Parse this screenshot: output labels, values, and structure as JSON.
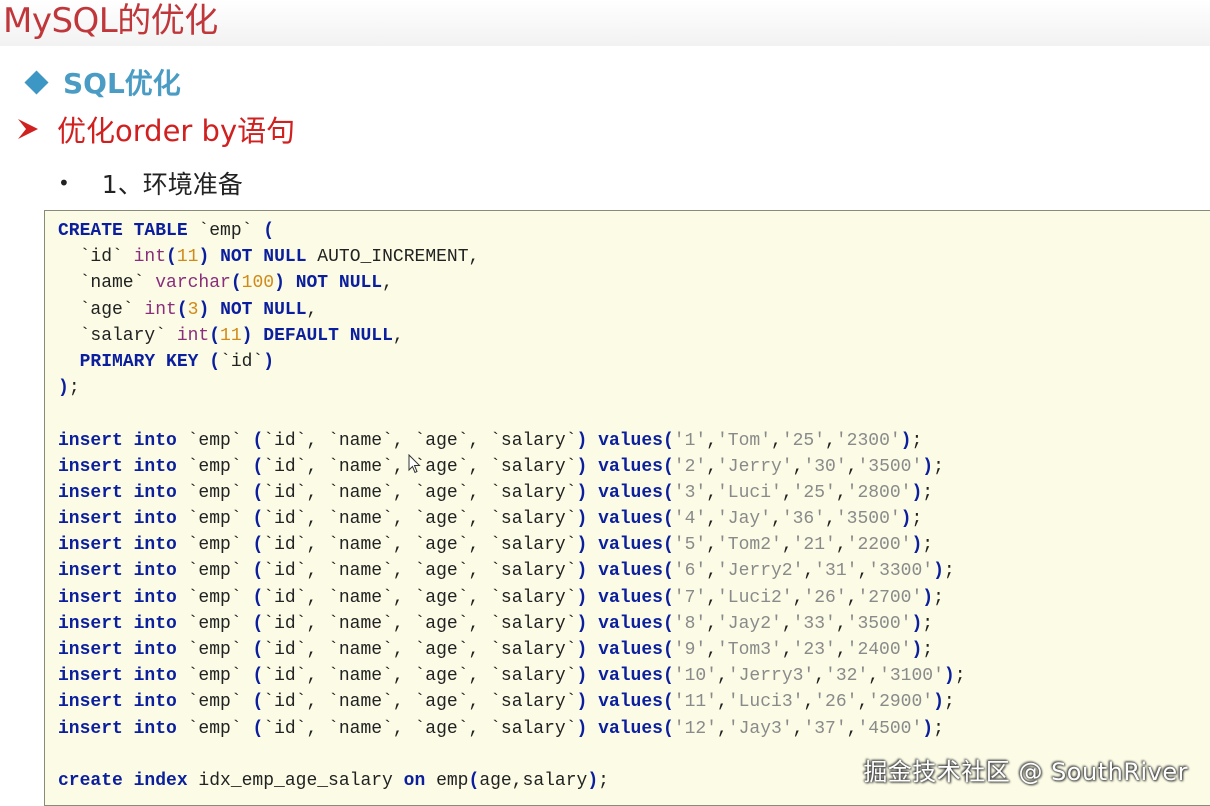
{
  "slide": {
    "title": "MySQL的优化",
    "heading1": "SQL优化",
    "heading2": "优化order by语句",
    "bullet": "1、环境准备"
  },
  "code": {
    "create_table": [
      [
        [
          "kw",
          "CREATE TABLE"
        ],
        [
          "t",
          " `emp` "
        ],
        [
          "op",
          "("
        ]
      ],
      [
        [
          "t",
          "  `id` "
        ],
        [
          "ty",
          "int"
        ],
        [
          "op",
          "("
        ],
        [
          "num",
          "11"
        ],
        [
          "op",
          ")"
        ],
        [
          "t",
          " "
        ],
        [
          "kw",
          "NOT NULL"
        ],
        [
          "t",
          " AUTO_INCREMENT,"
        ]
      ],
      [
        [
          "t",
          "  `name` "
        ],
        [
          "ty",
          "varchar"
        ],
        [
          "op",
          "("
        ],
        [
          "num",
          "100"
        ],
        [
          "op",
          ")"
        ],
        [
          "t",
          " "
        ],
        [
          "kw",
          "NOT NULL"
        ],
        [
          "t",
          ","
        ]
      ],
      [
        [
          "t",
          "  `age` "
        ],
        [
          "ty",
          "int"
        ],
        [
          "op",
          "("
        ],
        [
          "num",
          "3"
        ],
        [
          "op",
          ")"
        ],
        [
          "t",
          " "
        ],
        [
          "kw",
          "NOT NULL"
        ],
        [
          "t",
          ","
        ]
      ],
      [
        [
          "t",
          "  `salary` "
        ],
        [
          "ty",
          "int"
        ],
        [
          "op",
          "("
        ],
        [
          "num",
          "11"
        ],
        [
          "op",
          ")"
        ],
        [
          "t",
          " "
        ],
        [
          "kw",
          "DEFAULT NULL"
        ],
        [
          "t",
          ","
        ]
      ],
      [
        [
          "t",
          "  "
        ],
        [
          "kw",
          "PRIMARY KEY"
        ],
        [
          "t",
          " "
        ],
        [
          "op",
          "("
        ],
        [
          "t",
          "`id`"
        ],
        [
          "op",
          ")"
        ]
      ],
      [
        [
          "op",
          ")"
        ],
        [
          "t",
          ";"
        ]
      ]
    ],
    "insert_prefix": "insert into",
    "insert_table": " `emp` ",
    "insert_columns": "(`id`, `name`, `age`, `salary`)",
    "insert_values_kw": "values",
    "rows": [
      [
        "1",
        "Tom",
        "25",
        "2300"
      ],
      [
        "2",
        "Jerry",
        "30",
        "3500"
      ],
      [
        "3",
        "Luci",
        "25",
        "2800"
      ],
      [
        "4",
        "Jay",
        "36",
        "3500"
      ],
      [
        "5",
        "Tom2",
        "21",
        "2200"
      ],
      [
        "6",
        "Jerry2",
        "31",
        "3300"
      ],
      [
        "7",
        "Luci2",
        "26",
        "2700"
      ],
      [
        "8",
        "Jay2",
        "33",
        "3500"
      ],
      [
        "9",
        "Tom3",
        "23",
        "2400"
      ],
      [
        "10",
        "Jerry3",
        "32",
        "3100"
      ],
      [
        "11",
        "Luci3",
        "26",
        "2900"
      ],
      [
        "12",
        "Jay3",
        "37",
        "4500"
      ]
    ],
    "create_index": [
      [
        "kw",
        "create index"
      ],
      [
        "t",
        " idx_emp_age_salary "
      ],
      [
        "kw",
        "on"
      ],
      [
        "t",
        " emp"
      ],
      [
        "op",
        "("
      ],
      [
        "t",
        "age,salary"
      ],
      [
        "op",
        ")"
      ],
      [
        "t",
        ";"
      ]
    ]
  },
  "watermark": "掘金技术社区 @ SouthRiver",
  "icons": {
    "h1": "diamond-icon",
    "h2": "arrow-icon",
    "cursor": "mouse-cursor-icon"
  },
  "colors": {
    "title": "#c0373b",
    "heading1": "#4a9cc4",
    "heading2": "#d0201f",
    "code_bg": "#fbfbe6",
    "keyword": "#0b1f9e"
  }
}
